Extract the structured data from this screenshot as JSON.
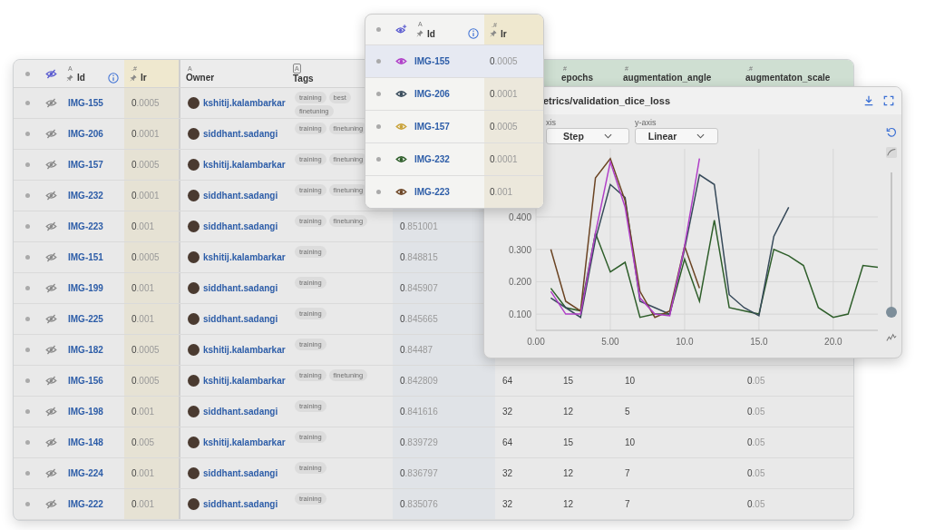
{
  "table": {
    "visibility_toggle": {
      "visible": false
    },
    "columns": [
      {
        "label": "Id",
        "type_mark": "A",
        "pinned": true,
        "info": true
      },
      {
        "label": "lr",
        "type_mark": ".#",
        "pinned": true
      },
      {
        "label": "Owner",
        "type_mark": "A"
      },
      {
        "label": "Tags",
        "type_mark": "A"
      },
      {
        "label": "epochs",
        "type_mark": "#"
      },
      {
        "label": "augmentation_angle",
        "type_mark": "#"
      },
      {
        "label": "augmentaton_scale",
        "type_mark": ".#"
      }
    ],
    "rows": [
      {
        "id": "IMG-155",
        "visible": false,
        "lr": "0.0005",
        "owner": "kshitij.kalambarkar",
        "tags": [
          "training",
          "best",
          "finetuning"
        ]
      },
      {
        "id": "IMG-206",
        "visible": false,
        "lr": "0.0001",
        "owner": "siddhant.sadangi",
        "tags": [
          "training",
          "finetuning"
        ]
      },
      {
        "id": "IMG-157",
        "visible": false,
        "lr": "0.0005",
        "owner": "kshitij.kalambarkar",
        "tags": [
          "training",
          "finetuning"
        ]
      },
      {
        "id": "IMG-232",
        "visible": false,
        "lr": "0.0001",
        "owner": "siddhant.sadangi",
        "tags": [
          "training",
          "finetuning"
        ]
      },
      {
        "id": "IMG-223",
        "visible": false,
        "lr": "0.001",
        "owner": "siddhant.sadangi",
        "tags": [
          "training",
          "finetuning"
        ],
        "column_7": "0.851001"
      },
      {
        "id": "IMG-151",
        "visible": false,
        "lr": "0.0005",
        "owner": "kshitij.kalambarkar",
        "tags": [
          "training"
        ],
        "column_7": "0.848815"
      },
      {
        "id": "IMG-199",
        "visible": false,
        "lr": "0.001",
        "owner": "siddhant.sadangi",
        "tags": [
          "training"
        ],
        "column_7": "0.845907"
      },
      {
        "id": "IMG-225",
        "visible": false,
        "lr": "0.001",
        "owner": "siddhant.sadangi",
        "tags": [
          "training"
        ],
        "column_7": "0.845665"
      },
      {
        "id": "IMG-182",
        "visible": false,
        "lr": "0.0005",
        "owner": "kshitij.kalambarkar",
        "tags": [
          "training"
        ],
        "column_7": "0.84487"
      },
      {
        "id": "IMG-156",
        "visible": false,
        "lr": "0.0005",
        "owner": "kshitij.kalambarkar",
        "tags": [
          "training",
          "finetuning"
        ],
        "column_7": "0.842809",
        "column_8": "64",
        "epochs": "15",
        "augmentation_angle": "10",
        "augmentaton_scale": "0.05"
      },
      {
        "id": "IMG-198",
        "visible": false,
        "lr": "0.001",
        "owner": "siddhant.sadangi",
        "tags": [
          "training"
        ],
        "column_7": "0.841616",
        "column_8": "32",
        "epochs": "12",
        "augmentation_angle": "5",
        "augmentaton_scale": "0.05"
      },
      {
        "id": "IMG-148",
        "visible": false,
        "lr": "0.005",
        "owner": "kshitij.kalambarkar",
        "tags": [
          "training"
        ],
        "column_7": "0.839729",
        "column_8": "64",
        "epochs": "15",
        "augmentation_angle": "10",
        "augmentaton_scale": "0.05"
      },
      {
        "id": "IMG-224",
        "visible": false,
        "lr": "0.001",
        "owner": "siddhant.sadangi",
        "tags": [
          "training"
        ],
        "column_7": "0.836797",
        "column_8": "32",
        "epochs": "12",
        "augmentation_angle": "7",
        "augmentaton_scale": "0.05"
      },
      {
        "id": "IMG-222",
        "visible": false,
        "lr": "0.001",
        "owner": "siddhant.sadangi",
        "tags": [
          "training"
        ],
        "column_7": "0.835076",
        "column_8": "32",
        "epochs": "12",
        "augmentation_angle": "7",
        "augmentaton_scale": "0.05"
      }
    ]
  },
  "popup": {
    "columns": [
      {
        "label": "Id",
        "type_mark": "A",
        "pinned": true,
        "info": true
      },
      {
        "label": "lr",
        "type_mark": ".#",
        "pinned": true
      }
    ],
    "rows": [
      {
        "id": "IMG-155",
        "lr": "0.0005",
        "color": "#b03fc8",
        "selected": true
      },
      {
        "id": "IMG-206",
        "lr": "0.0001",
        "color": "#374a5a",
        "selected": false
      },
      {
        "id": "IMG-157",
        "lr": "0.0005",
        "color": "#c9a33a",
        "selected": false
      },
      {
        "id": "IMG-232",
        "lr": "0.0001",
        "color": "#2e5e2a",
        "selected": false
      },
      {
        "id": "IMG-223",
        "lr": "0.001",
        "color": "#6b4423",
        "selected": false
      }
    ]
  },
  "chart_panel": {
    "title": "etrics/validation_dice_loss",
    "x_axis": {
      "label": "xis",
      "value": "Step"
    },
    "y_axis": {
      "label": "y-axis",
      "value": "Linear"
    },
    "smoothing": {
      "level": 0
    },
    "chart_data": {
      "type": "line",
      "x": [
        1,
        2,
        3,
        4,
        5,
        6,
        7,
        8,
        9,
        10,
        11,
        12,
        13,
        14,
        15,
        16,
        17,
        18,
        19,
        20,
        21,
        22,
        23
      ],
      "xlim": [
        0,
        23
      ],
      "ylim": [
        0.05,
        0.61
      ],
      "grid": true,
      "xticks": [
        {
          "value": 0,
          "label": "0.00"
        },
        {
          "value": 5,
          "label": "5.00"
        },
        {
          "value": 10,
          "label": "10.0"
        },
        {
          "value": 15,
          "label": "15.0"
        },
        {
          "value": 20,
          "label": "20.0"
        }
      ],
      "yticks": [
        {
          "value": 0.1,
          "label": "0.100"
        },
        {
          "value": 0.2,
          "label": "0.200"
        },
        {
          "value": 0.3,
          "label": "0.300"
        },
        {
          "value": 0.4,
          "label": "0.400"
        }
      ],
      "series": [
        {
          "color": "#2e5e2a",
          "values": [
            0.18,
            0.12,
            0.11,
            0.35,
            0.23,
            0.26,
            0.09,
            0.1,
            0.1,
            0.27,
            0.14,
            0.39,
            0.12,
            0.11,
            0.1,
            0.3,
            0.28,
            0.25,
            0.12,
            0.09,
            0.1,
            0.25,
            0.245
          ]
        },
        {
          "color": "#374a5a",
          "values": [
            0.15,
            0.12,
            0.09,
            0.33,
            0.5,
            0.46,
            0.14,
            0.12,
            0.1,
            0.3,
            0.53,
            0.5,
            0.16,
            0.12,
            0.095,
            0.34,
            0.43,
            null,
            null,
            null,
            null,
            null,
            null
          ]
        },
        {
          "color": "#6b4423",
          "values": [
            0.3,
            0.14,
            0.11,
            0.52,
            0.58,
            0.45,
            0.17,
            0.09,
            0.11,
            0.31,
            0.18,
            null,
            null,
            null,
            null,
            null,
            null,
            null,
            null,
            null,
            null,
            null,
            null
          ]
        },
        {
          "color": "#b03fc8",
          "values": [
            0.17,
            0.1,
            0.1,
            0.35,
            0.57,
            0.43,
            0.15,
            0.1,
            0.095,
            0.31,
            0.58,
            null,
            null,
            null,
            null,
            null,
            null,
            null,
            null,
            null,
            null,
            null,
            null
          ]
        }
      ]
    }
  }
}
